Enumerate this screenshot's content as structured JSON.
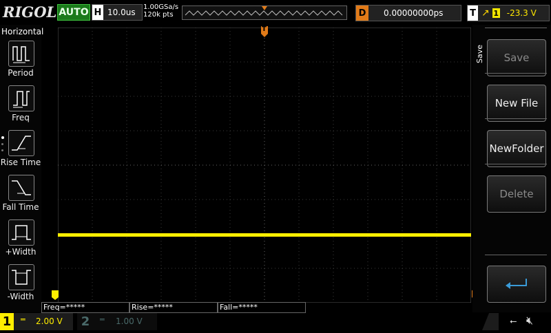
{
  "header": {
    "logo": "RIGOL",
    "run_state": "AUTO",
    "timebase_key": "H",
    "timebase_value": "10.0us",
    "sample_rate": "1.00GSa/s",
    "memory_depth": "120k pts",
    "delay_key": "D",
    "delay_value": "0.00000000ps",
    "trigger_key": "T",
    "trigger_edge_icon": "rising-edge-icon",
    "trigger_source": "1",
    "trigger_level": "-23.3 V",
    "trigger_marker": "T"
  },
  "left_menu": {
    "title": "Horizontal",
    "items": [
      {
        "label": "Period",
        "icon": "period-icon"
      },
      {
        "label": "Freq",
        "icon": "freq-icon"
      },
      {
        "label": "Rise Time",
        "icon": "rise-time-icon"
      },
      {
        "label": "Fall Time",
        "icon": "fall-time-icon"
      },
      {
        "label": "+Width",
        "icon": "positive-width-icon"
      },
      {
        "label": "-Width",
        "icon": "negative-width-icon"
      }
    ]
  },
  "right_menu": {
    "title": "Save",
    "buttons": [
      {
        "label": "Save",
        "enabled": false
      },
      {
        "label": "New File",
        "enabled": true
      },
      {
        "label": "NewFolder",
        "enabled": true
      },
      {
        "label": "Delete",
        "enabled": false
      },
      {
        "label": "",
        "icon": "enter-return-icon",
        "enabled": true
      }
    ]
  },
  "measurements": [
    {
      "label": "Freq=*****"
    },
    {
      "label": "Rise=*****"
    },
    {
      "label": "Fall=*****"
    }
  ],
  "channels": {
    "ch1": {
      "number": "1",
      "scale": "2.00 V",
      "coupling_icon": "dc-coupling-icon",
      "color": "#ffee00"
    },
    "ch2": {
      "number": "2",
      "scale": "1.00 V",
      "coupling_icon": "dc-coupling-icon",
      "color": "#4a6a6a"
    }
  },
  "status": {
    "usb_icon": "usb-icon",
    "sound_icon": "speaker-muted-icon"
  },
  "colors": {
    "trace": "#ffee00",
    "trigger_marker": "#e07a18",
    "grid": "#4a4a4a"
  }
}
